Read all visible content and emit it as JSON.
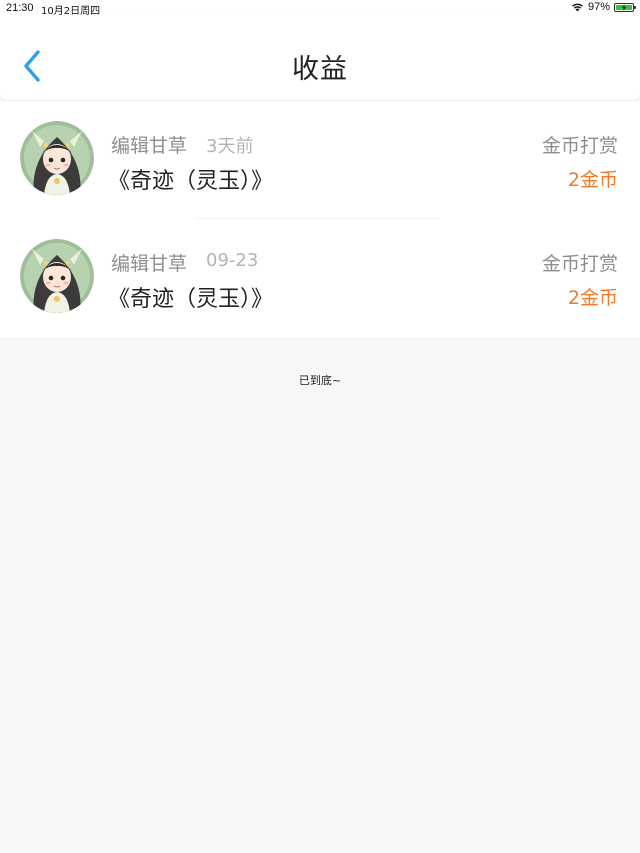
{
  "status_bar": {
    "time": "21:30",
    "date": "10月2日周四",
    "battery_text": "97%",
    "battery_level": 0.97,
    "icons": [
      "wifi-icon",
      "battery-charging-icon"
    ]
  },
  "header": {
    "title": "收益",
    "back_icon": "chevron-left-icon",
    "accent_color": "#2f9ff0"
  },
  "records": [
    {
      "editor": "编辑甘草",
      "time": "3天前",
      "book": "《奇迹（灵玉）》",
      "type": "金币打赏",
      "amount": "2金币"
    },
    {
      "editor": "编辑甘草",
      "time": "09-23",
      "book": "《奇迹（灵玉）》",
      "type": "金币打赏",
      "amount": "2金币"
    }
  ],
  "footer": {
    "end_text": "已到底~"
  },
  "colors": {
    "amount": "#f07a2a",
    "secondary_text": "#8e8e8e",
    "background": "#f8f6f7"
  }
}
